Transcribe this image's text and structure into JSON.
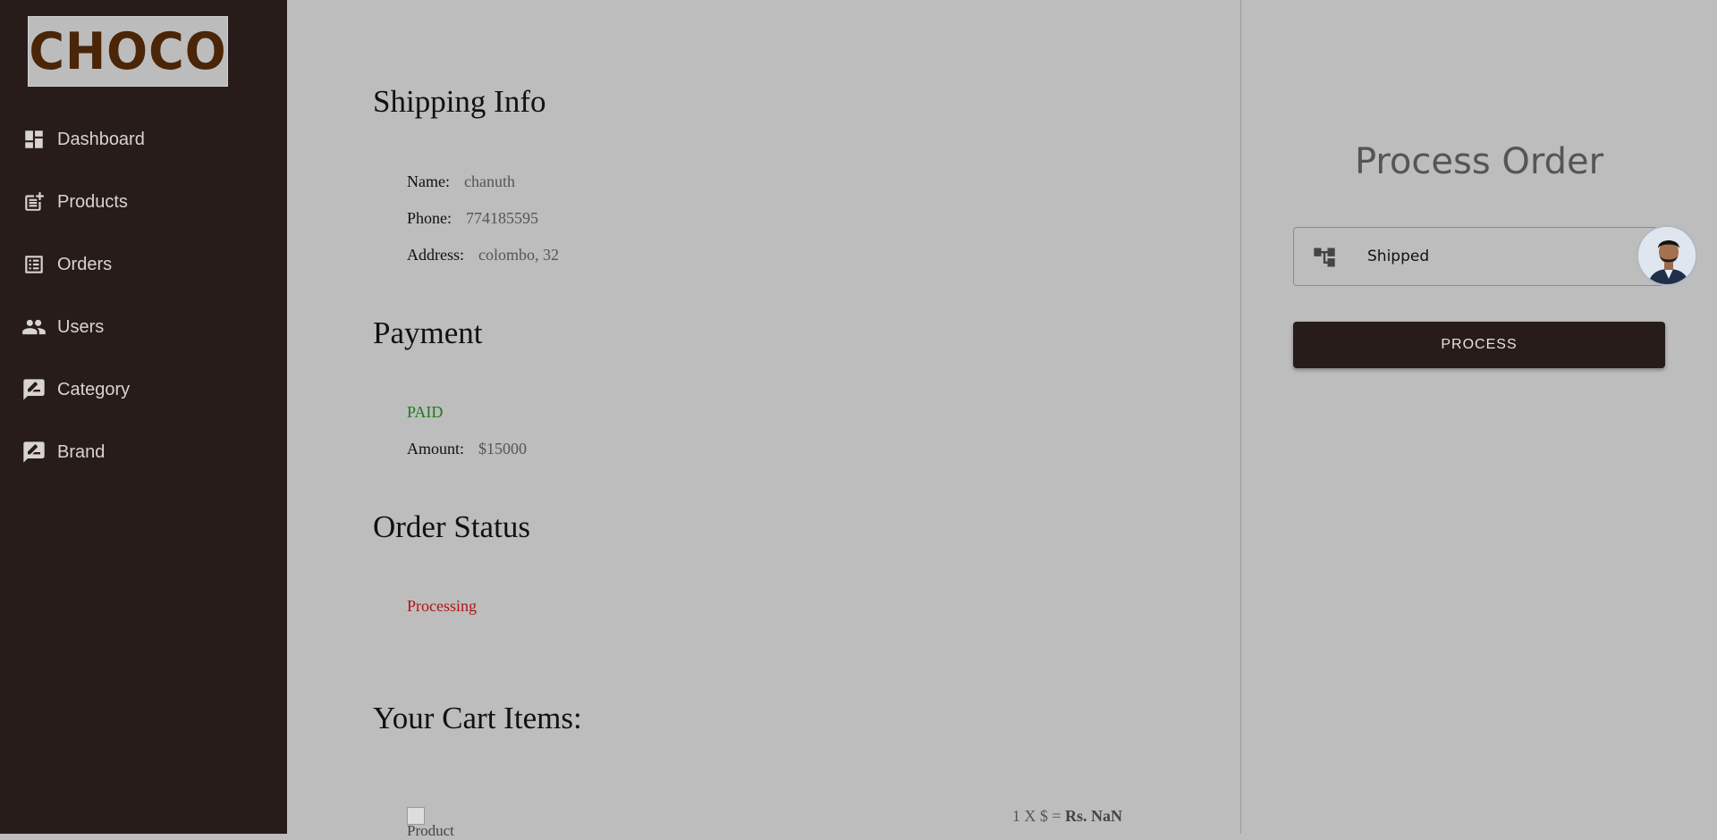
{
  "app": {
    "logo_text": "CHOCO"
  },
  "sidebar": {
    "items": [
      {
        "label": "Dashboard",
        "icon": "dashboard-icon"
      },
      {
        "label": "Products",
        "icon": "post-add-icon"
      },
      {
        "label": "Orders",
        "icon": "list-alt-icon"
      },
      {
        "label": "Users",
        "icon": "people-icon"
      },
      {
        "label": "Category",
        "icon": "rate-review-icon"
      },
      {
        "label": "Brand",
        "icon": "rate-review-icon"
      }
    ]
  },
  "shipping": {
    "title": "Shipping Info",
    "name_label": "Name:",
    "name_value": "chanuth",
    "phone_label": "Phone:",
    "phone_value": "774185595",
    "address_label": "Address:",
    "address_value": "colombo, 32"
  },
  "payment": {
    "title": "Payment",
    "status": "PAID",
    "amount_label": "Amount:",
    "amount_value": "$15000"
  },
  "order_status": {
    "title": "Order Status",
    "value": "Processing"
  },
  "cart": {
    "title": "Your Cart Items:",
    "items": [
      {
        "image_alt": "Product",
        "qty_text": "1 X $ =",
        "total": "Rs. NaN"
      }
    ]
  },
  "process": {
    "title": "Process Order",
    "select_value": "Shipped",
    "button_label": "PROCESS"
  },
  "colors": {
    "sidebar_bg": "#271c19",
    "content_bg": "#bdbdbd",
    "paid": "#1b7a1b",
    "processing": "#b01414",
    "button_bg": "#271c19"
  }
}
